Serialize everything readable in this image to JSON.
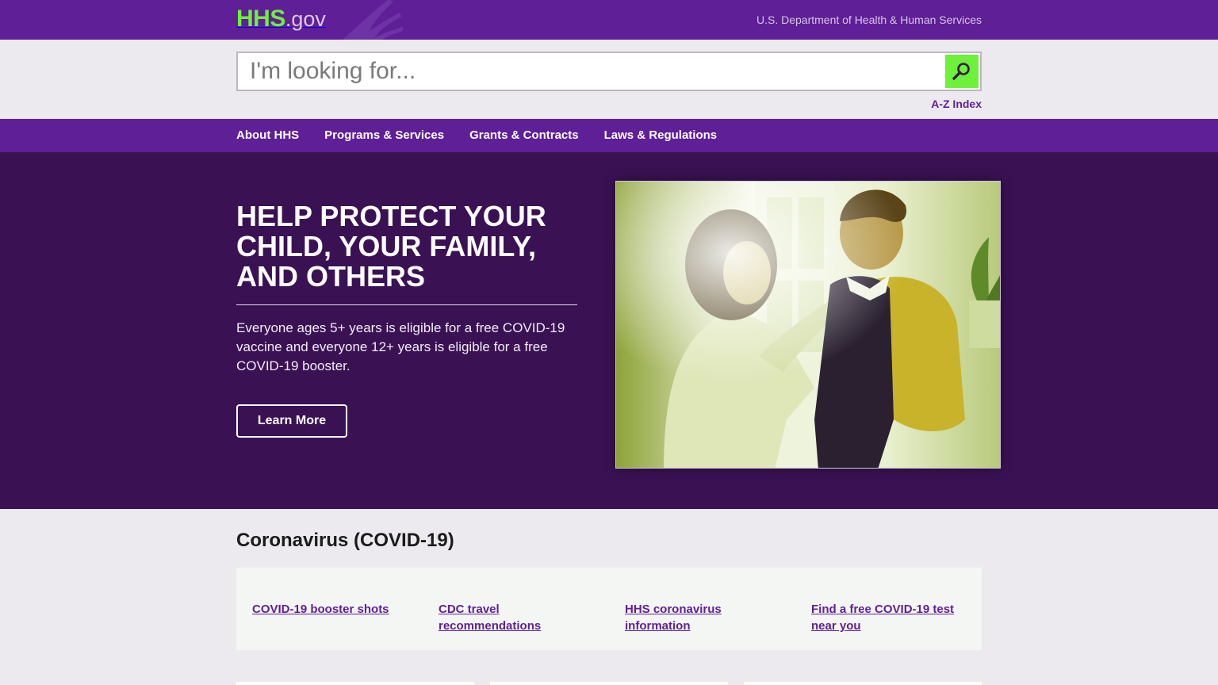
{
  "topbar": {
    "logo_hhs": "HHS",
    "logo_gov": ".gov",
    "department": "U.S. Department of Health & Human Services"
  },
  "search": {
    "placeholder": "I'm looking for...",
    "button_icon": "search-icon",
    "az_index": "A-Z Index"
  },
  "nav": {
    "items": [
      {
        "label": "About HHS"
      },
      {
        "label": "Programs & Services"
      },
      {
        "label": "Grants & Contracts"
      },
      {
        "label": "Laws & Regulations"
      }
    ]
  },
  "hero": {
    "title": "HELP PROTECT YOUR CHILD, YOUR FAMILY, AND OTHERS",
    "text": "Everyone ages 5+ years is eligible for a free COVID-19 vaccine and everyone 12+ years is eligible for a free COVID-19 booster.",
    "button_label": "Learn More"
  },
  "covid": {
    "title": "Coronavirus (COVID-19)",
    "links": [
      {
        "label": "COVID-19 booster shots"
      },
      {
        "label": "CDC travel recommendations"
      },
      {
        "label": "HHS coronavirus information"
      },
      {
        "label": "Find a free COVID-19 test near you"
      }
    ]
  },
  "colors": {
    "brand_purple": "#5f1f97",
    "hero_purple": "#3a1254",
    "accent_green": "#6ef13a"
  }
}
